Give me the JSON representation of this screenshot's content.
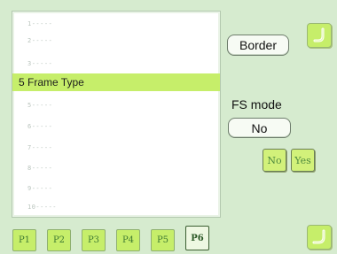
{
  "list": {
    "rows": [
      {
        "text": "1-----",
        "selected": false
      },
      {
        "text": "2-----",
        "selected": false
      },
      {
        "text": "3-----",
        "selected": false
      },
      {
        "text": "5 Frame Type",
        "selected": true
      },
      {
        "text": "5-----",
        "selected": false
      },
      {
        "text": "6-----",
        "selected": false
      },
      {
        "text": "7-----",
        "selected": false
      },
      {
        "text": "8-----",
        "selected": false
      },
      {
        "text": "9-----",
        "selected": false
      },
      {
        "text": "10-----",
        "selected": false
      }
    ]
  },
  "right_panel": {
    "border_button": "Border",
    "fs_label": "FS mode",
    "fs_value": "No",
    "no_button": "No",
    "yes_button": "Yes"
  },
  "tabs": [
    {
      "label": "P1",
      "active": false
    },
    {
      "label": "P2",
      "active": false
    },
    {
      "label": "P3",
      "active": false
    },
    {
      "label": "P4",
      "active": false
    },
    {
      "label": "P5",
      "active": false
    },
    {
      "label": "P6",
      "active": true
    }
  ],
  "colors": {
    "background": "#d6ebcf",
    "accent_green": "#c6ee6a",
    "selected_row": "#c6ee6a"
  },
  "icons": {
    "top_right": "curved-arrow-up-icon",
    "bottom_right": "curved-arrow-down-icon"
  }
}
